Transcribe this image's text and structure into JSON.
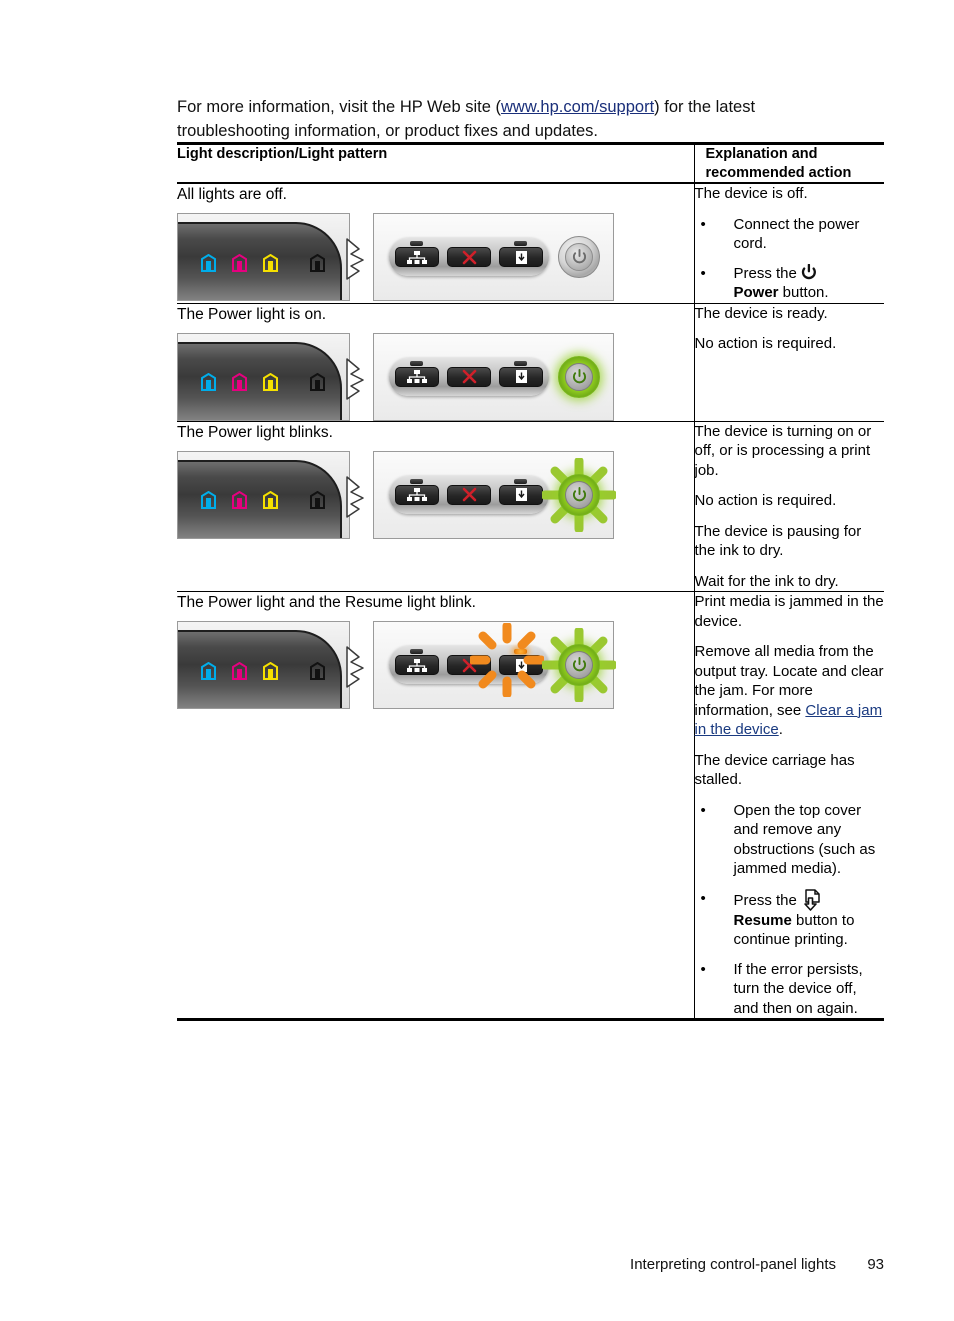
{
  "intro": {
    "before_link": "For more information, visit the HP Web site (",
    "link_text": "www.hp.com/support",
    "after_link": ") for the latest troubleshooting information, or product fixes and updates."
  },
  "table": {
    "headers": {
      "left": "Light description/Light pattern",
      "right": "Explanation and recommended action"
    },
    "rows": [
      {
        "description": "All lights are off.",
        "figure": {
          "power_state": "off",
          "resume_state": "off",
          "power_blinking": false,
          "resume_blinking": false
        },
        "explanation": {
          "lead": "The device is off.",
          "bullets": [
            {
              "text": "Connect the power cord.",
              "icon": "none",
              "bold_word": ""
            },
            {
              "text_before": "Press the ",
              "icon": "power-icon",
              "bold_word": "Power",
              "text_after": " button."
            }
          ],
          "paras": []
        }
      },
      {
        "description": "The Power light is on.",
        "figure": {
          "power_state": "on",
          "resume_state": "off",
          "power_blinking": false,
          "resume_blinking": false
        },
        "explanation": {
          "lead": "",
          "bullets": [],
          "paras": [
            "The device is ready.",
            "No action is required."
          ]
        }
      },
      {
        "description": "The Power light blinks.",
        "figure": {
          "power_state": "on",
          "resume_state": "off",
          "power_blinking": true,
          "resume_blinking": false
        },
        "explanation": {
          "lead": "",
          "bullets": [],
          "paras": [
            "The device is turning on or off, or is processing a print job.",
            "No action is required.",
            "The device is pausing for the ink to dry.",
            "Wait for the ink to dry."
          ]
        }
      },
      {
        "description": "The Power light and the Resume light blink.",
        "figure": {
          "power_state": "on",
          "resume_state": "on",
          "power_blinking": true,
          "resume_blinking": true
        },
        "explanation": {
          "lead": "",
          "bullets": [],
          "paras": []
        }
      }
    ]
  },
  "row4_content": {
    "para1": "Print media is jammed in the device.",
    "para2_before": "Remove all media from the output tray. Locate and clear the jam. For more information, see ",
    "para2_link": "Clear a jam in the device",
    "para2_after": ".",
    "para3": "The device carriage has stalled.",
    "bullet1": "Open the top cover and remove any obstructions (such as jammed media).",
    "bullet2_before": "Press the ",
    "bullet2_bold": "Resume",
    "bullet2_after": " button to continue printing.",
    "bullet3": "If the error persists, turn the device off, and then on again."
  },
  "panel": {
    "ink_icons": [
      "cyan-ink-icon",
      "magenta-ink-icon",
      "yellow-ink-icon",
      "black-ink-icon"
    ],
    "ink_colors": [
      "#00adea",
      "#e5007f",
      "#f5e000",
      "#1a1a1a"
    ],
    "buttons": [
      "network-button",
      "cancel-button",
      "resume-button"
    ],
    "power_button": "power-button",
    "cancel_color": "#d0202a",
    "ray_green": "#9bc832",
    "ray_orange": "#f18a1e"
  },
  "footer": {
    "section": "Interpreting control-panel lights",
    "page_number": "93"
  }
}
